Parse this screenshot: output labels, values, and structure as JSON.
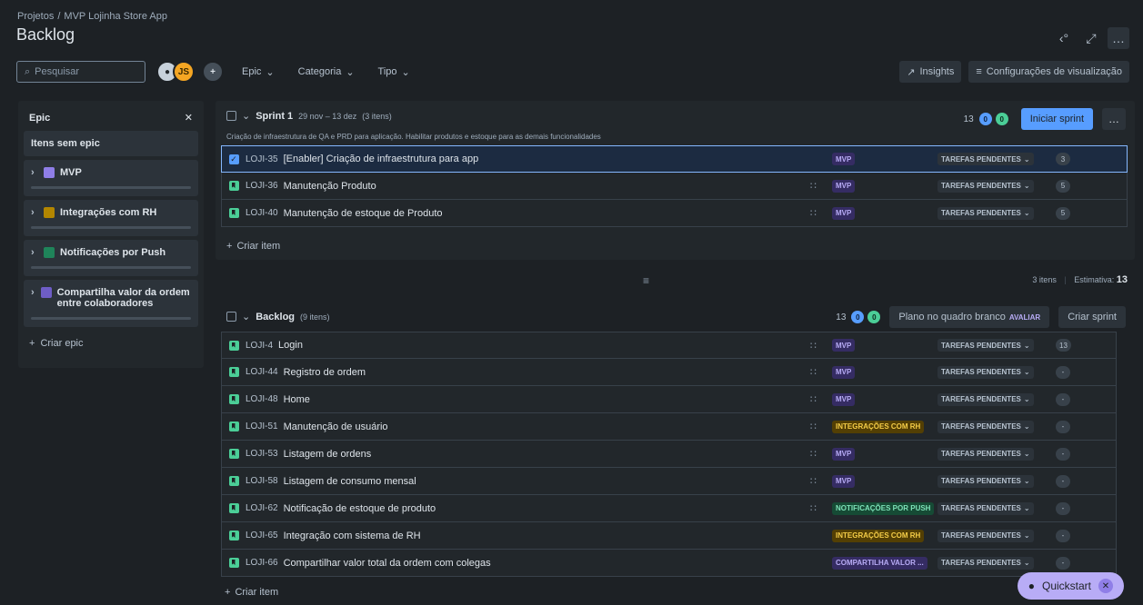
{
  "breadcrumb": {
    "root": "Projetos",
    "separator": "/",
    "project": "MVP Lojinha Store App"
  },
  "page_title": "Backlog",
  "toolbar": {
    "search_placeholder": "Pesquisar",
    "avatar_initials": "JS",
    "filters": [
      "Epic",
      "Categoria",
      "Tipo"
    ],
    "insights_label": "Insights",
    "view_settings_label": "Configurações de visualização"
  },
  "epic_panel": {
    "title": "Epic",
    "no_epic_label": "Itens sem epic",
    "epics": [
      {
        "name": "MVP",
        "color": "#8f7ee7"
      },
      {
        "name": "Integrações com RH",
        "color": "#b38600"
      },
      {
        "name": "Notificações por Push",
        "color": "#1f845a"
      },
      {
        "name": "Compartilha valor da ordem entre colaboradores",
        "color": "#6e5dc6"
      }
    ],
    "create_epic_label": "Criar epic"
  },
  "sprint": {
    "name": "Sprint 1",
    "dates": "29 nov – 13 dez",
    "count": "(3 itens)",
    "goal": "Criação de infraestrutura de QA e PRD para aplicação. Habilitar produtos e estoque para as demais funcionalidades",
    "points_todo": "13",
    "points_inprogress": "0",
    "points_done": "0",
    "start_label": "Iniciar sprint",
    "items": [
      {
        "key": "LOJI-35",
        "summary": "[Enabler] Criação de infraestrutura para app",
        "epic": "MVP",
        "status": "TAREFAS PENDENTES",
        "estimate": "3"
      },
      {
        "key": "LOJI-36",
        "summary": "Manutenção Produto",
        "epic": "MVP",
        "status": "TAREFAS PENDENTES",
        "estimate": "5"
      },
      {
        "key": "LOJI-40",
        "summary": "Manutenção de estoque de Produto",
        "epic": "MVP",
        "status": "TAREFAS PENDENTES",
        "estimate": "5"
      }
    ],
    "create_item_label": "Criar item",
    "totals_items": "3 itens",
    "totals_estimate_label": "Estimativa:",
    "totals_estimate": "13"
  },
  "backlog": {
    "name": "Backlog",
    "count": "(9 itens)",
    "points_todo": "13",
    "points_inprogress": "0",
    "points_done": "0",
    "whiteboard_label": "Plano no quadro branco",
    "whiteboard_badge": "AVALIAR",
    "create_sprint_label": "Criar sprint",
    "items": [
      {
        "key": "LOJI-4",
        "summary": "Login",
        "epic": "MVP",
        "status": "TAREFAS PENDENTES",
        "estimate": "13"
      },
      {
        "key": "LOJI-44",
        "summary": "Registro de ordem",
        "epic": "MVP",
        "status": "TAREFAS PENDENTES",
        "estimate": "-"
      },
      {
        "key": "LOJI-48",
        "summary": "Home",
        "epic": "MVP",
        "status": "TAREFAS PENDENTES",
        "estimate": "-"
      },
      {
        "key": "LOJI-51",
        "summary": "Manutenção de usuário",
        "epic": "INTEGRAÇÕES COM RH",
        "status": "TAREFAS PENDENTES",
        "estimate": "-"
      },
      {
        "key": "LOJI-53",
        "summary": "Listagem de ordens",
        "epic": "MVP",
        "status": "TAREFAS PENDENTES",
        "estimate": "-"
      },
      {
        "key": "LOJI-58",
        "summary": "Listagem de consumo mensal",
        "epic": "MVP",
        "status": "TAREFAS PENDENTES",
        "estimate": "-"
      },
      {
        "key": "LOJI-62",
        "summary": "Notificação de estoque de produto",
        "epic": "NOTIFICAÇÕES POR PUSH",
        "status": "TAREFAS PENDENTES",
        "estimate": "-"
      },
      {
        "key": "LOJI-65",
        "summary": "Integração com sistema de RH",
        "epic": "INTEGRAÇÕES COM RH",
        "status": "TAREFAS PENDENTES",
        "estimate": "-"
      },
      {
        "key": "LOJI-66",
        "summary": "Compartilhar valor total da ordem com colegas",
        "epic": "COMPARTILHA VALOR ...",
        "status": "TAREFAS PENDENTES",
        "estimate": "-"
      }
    ],
    "create_item_label": "Criar item"
  },
  "quickstart_label": "Quickstart"
}
